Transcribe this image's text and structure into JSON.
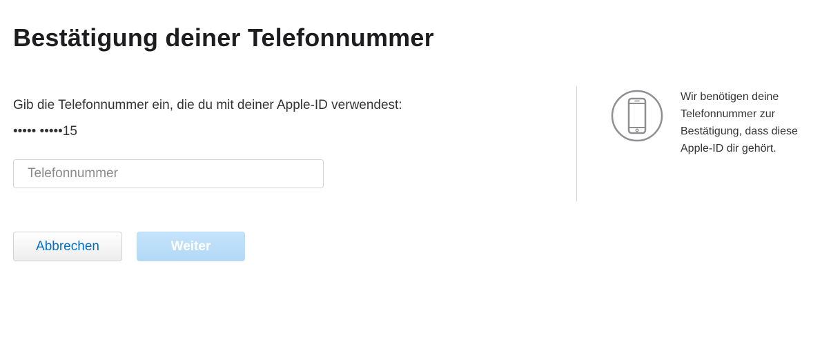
{
  "page": {
    "title": "Bestätigung deiner Telefonnummer"
  },
  "form": {
    "instruction": "Gib die Telefonnummer ein, die du mit deiner Apple-ID verwendest:",
    "masked_phone": "••••• •••••15",
    "phone_input": {
      "value": "",
      "placeholder": "Telefonnummer"
    }
  },
  "buttons": {
    "cancel_label": "Abbrechen",
    "next_label": "Weiter",
    "next_enabled": false
  },
  "sidebar": {
    "icon": "iphone-icon",
    "info_text": "Wir benötigen deine Telefonnummer zur Bestätigung, dass diese Apple-ID dir gehört."
  },
  "colors": {
    "link_blue": "#0070c9",
    "disabled_button": "#b3d9f6",
    "icon_gray": "#8e8e93"
  }
}
